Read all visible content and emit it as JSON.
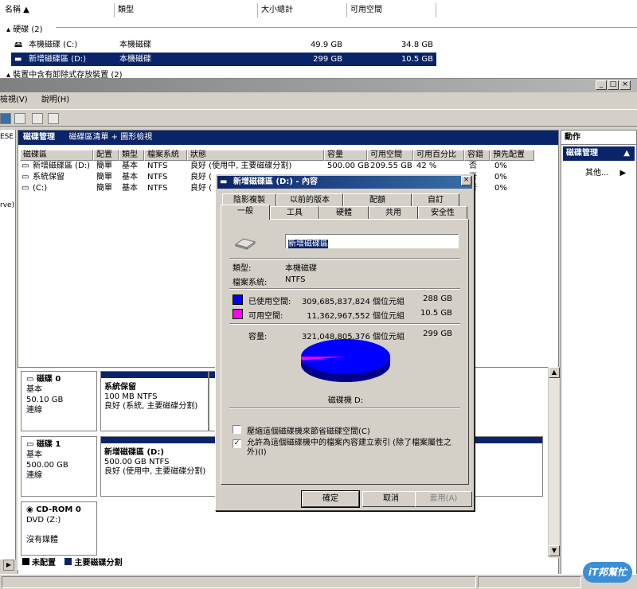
{
  "explorer": {
    "columns": [
      "名稱",
      "類型",
      "大小總計",
      "可用空間"
    ],
    "group_hdd": "硬碟 (2)",
    "group_removable": "裝置中含有卸除式存放裝置 (2)",
    "rows": [
      {
        "name": "本機磁碟 (C:)",
        "type": "本機磁碟",
        "size": "49.9 GB",
        "free": "34.8 GB"
      },
      {
        "name": "新增磁碟區 (D:)",
        "type": "本機磁碟",
        "size": "299 GB",
        "free": "10.5 GB"
      }
    ]
  },
  "mmc": {
    "window_buttons": [
      "_",
      "□",
      "×"
    ],
    "menu": [
      "檢視(V)",
      "說明(H)"
    ],
    "tree_fragment": "ESE",
    "tree_fragment2": "rve)",
    "center_header": {
      "title": "磁碟管理",
      "subtitle": "磁碟區清單 + 圖形檢視"
    },
    "columns": [
      "磁碟區",
      "配置",
      "類型",
      "檔案系統",
      "狀態",
      "容量",
      "可用空間",
      "可用百分比",
      "容錯",
      "預先配置"
    ],
    "volumes": [
      {
        "name": "新增磁碟區 (D:)",
        "layout": "簡單",
        "type": "基本",
        "fs": "NTFS",
        "status": "良好 (使用中, 主要磁碟分割)",
        "capacity": "500.00 GB",
        "free": "209.55 GB",
        "pct": "42 %",
        "fault": "否",
        "overhead": "0%"
      },
      {
        "name": "系統保留",
        "layout": "簡單",
        "type": "基本",
        "fs": "NTFS",
        "status": "良好 (",
        "capacity": "",
        "free": "",
        "pct": "",
        "fault": "否",
        "overhead": "0%"
      },
      {
        "name": "(C:)",
        "layout": "簡單",
        "type": "基本",
        "fs": "NTFS",
        "status": "良好 (",
        "capacity": "",
        "free": "",
        "pct": "",
        "fault": "否",
        "overhead": "0%"
      }
    ],
    "actions": {
      "header": "動作",
      "selected": "磁碟管理",
      "item": "其他..."
    },
    "disks": [
      {
        "name": "磁碟 0",
        "type": "基本",
        "size": "50.10 GB",
        "state": "連線",
        "partition": {
          "name": "系統保留",
          "size": "100 MB NTFS",
          "status": "良好 (系統, 主要磁碟分割)"
        }
      },
      {
        "name": "磁碟 1",
        "type": "基本",
        "size": "500.00 GB",
        "state": "連線",
        "partition": {
          "name": "新增磁碟區  (D:)",
          "size": "500.00 GB NTFS",
          "status": "良好 (使用中, 主要磁碟分割)"
        }
      },
      {
        "name": "CD-ROM 0",
        "type": "DVD (Z:)",
        "state": "沒有媒體"
      }
    ],
    "legend": {
      "unallocated": "未配置",
      "primary": "主要磁碟分割"
    }
  },
  "dialog": {
    "title": "新增磁碟區 (D:) - 內容",
    "close": "×",
    "tabs_row1": [
      "陰影複製",
      "以前的版本",
      "配額",
      "自訂"
    ],
    "tabs_row2": [
      "一般",
      "工具",
      "硬體",
      "共用",
      "安全性"
    ],
    "volume_label": "新增磁碟區",
    "type_label": "類型:",
    "type_value": "本機磁碟",
    "fs_label": "檔案系統:",
    "fs_value": "NTFS",
    "used_label": "已使用空間:",
    "used_bytes": "309,685,837,824 個位元組",
    "used_gb": "288 GB",
    "free_label": "可用空間:",
    "free_bytes": "11,362,967,552 個位元組",
    "free_gb": "10.5 GB",
    "cap_label": "容量:",
    "cap_bytes": "321,048,805,376 個位元組",
    "cap_gb": "299 GB",
    "drive_caption": "磁碟機 D:",
    "compress_label": "壓縮這個磁碟機來節省磁碟空間(C)",
    "index_label": "允許為這個磁碟機中的檔案內容建立索引 (除了檔案屬性之外)(I)",
    "index_checked": "✓",
    "buttons": {
      "ok": "確定",
      "cancel": "取消",
      "apply": "套用(A)"
    },
    "colors": {
      "used": "#0000ff",
      "free": "#ff00ff"
    },
    "used_fraction": 0.965
  },
  "watermark": "iT邦幫忙"
}
